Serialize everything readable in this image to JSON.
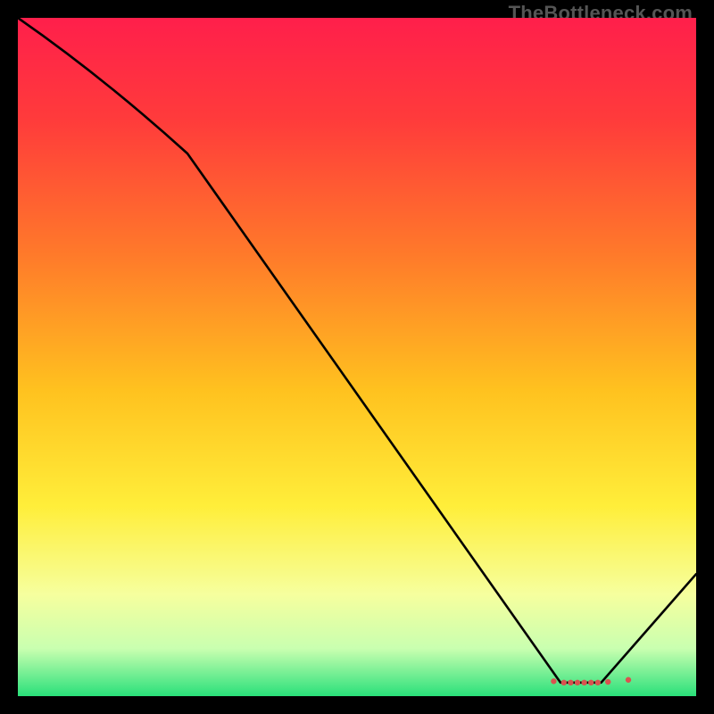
{
  "watermark": "TheBottleneck.com",
  "chart_data": {
    "type": "line",
    "title": "",
    "xlabel": "",
    "ylabel": "",
    "xlim": [
      0,
      100
    ],
    "ylim": [
      0,
      100
    ],
    "grid": false,
    "series": [
      {
        "name": "curve",
        "x": [
          0,
          25,
          80,
          86,
          100
        ],
        "values": [
          100,
          80,
          2,
          2,
          18
        ]
      }
    ],
    "markers": {
      "name": "dots-near-min",
      "x": [
        79,
        80.5,
        81.5,
        82.5,
        83.5,
        84.5,
        85.5,
        87,
        90
      ],
      "values": [
        2.2,
        2.0,
        2.0,
        2.0,
        2.0,
        2.0,
        2.0,
        2.1,
        2.4
      ],
      "color": "#d9534f",
      "radius": 3.2
    },
    "gradient_stops": [
      {
        "offset": 0.0,
        "color": "#ff1f4b"
      },
      {
        "offset": 0.15,
        "color": "#ff3b3b"
      },
      {
        "offset": 0.35,
        "color": "#ff7a2a"
      },
      {
        "offset": 0.55,
        "color": "#ffc21f"
      },
      {
        "offset": 0.72,
        "color": "#ffee3a"
      },
      {
        "offset": 0.85,
        "color": "#f6ff9e"
      },
      {
        "offset": 0.93,
        "color": "#c9ffb0"
      },
      {
        "offset": 1.0,
        "color": "#29e07a"
      }
    ]
  }
}
